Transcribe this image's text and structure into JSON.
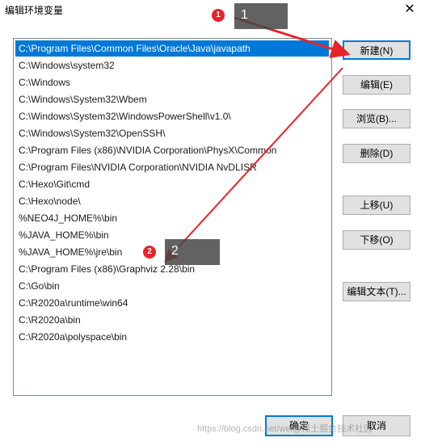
{
  "window": {
    "title": "编辑环境变量",
    "close_symbol": "✕"
  },
  "path_list": {
    "selected_index": 0,
    "items": [
      "C:\\Program Files\\Common Files\\Oracle\\Java\\javapath",
      "C:\\Windows\\system32",
      "C:\\Windows",
      "C:\\Windows\\System32\\Wbem",
      "C:\\Windows\\System32\\WindowsPowerShell\\v1.0\\",
      "C:\\Windows\\System32\\OpenSSH\\",
      "C:\\Program Files (x86)\\NVIDIA Corporation\\PhysX\\Common",
      "C:\\Program Files\\NVIDIA Corporation\\NVIDIA NvDLISR",
      "C:\\Hexo\\Git\\cmd",
      "C:\\Hexo\\node\\",
      "%NEO4J_HOME%\\bin",
      "%JAVA_HOME%\\bin",
      "%JAVA_HOME%\\jre\\bin",
      "C:\\Program Files (x86)\\Graphviz 2.28\\bin",
      "C:\\Go\\bin",
      "C:\\R2020a\\runtime\\win64",
      "C:\\R2020a\\bin",
      "C:\\R2020a\\polyspace\\bin"
    ]
  },
  "side_buttons": {
    "new": "新建(N)",
    "edit": "编辑(E)",
    "browse": "浏览(B)...",
    "delete": "删除(D)",
    "move_up": "上移(U)",
    "move_down": "下移(O)",
    "edit_text": "编辑文本(T)..."
  },
  "bottom_buttons": {
    "ok": "确定",
    "cancel": "取消"
  },
  "annotations": {
    "step1": {
      "circle": "1",
      "box": "1"
    },
    "step2": {
      "circle": "2",
      "box": "2"
    },
    "arrow_color": "#e8232a"
  },
  "watermark": "https://blog.csdn.net/wei@稀土掘金技术社区"
}
